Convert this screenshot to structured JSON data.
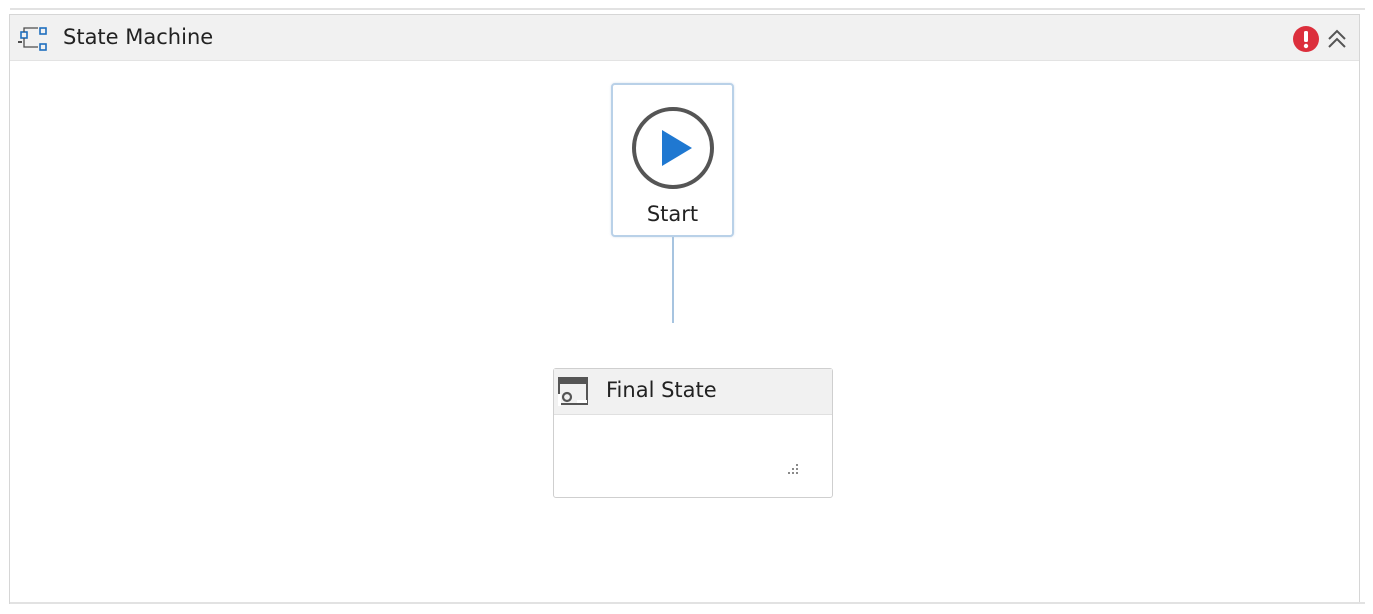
{
  "state_machine": {
    "title": "State Machine",
    "icons": {
      "type_icon": "state-machine-icon",
      "error_icon": "error-icon",
      "collapse_icon": "double-chevron-up-icon"
    },
    "colors": {
      "error": "#dc2f3c",
      "accent": "#1f78d1",
      "connector": "#a7c4e0"
    }
  },
  "nodes": {
    "start": {
      "label": "Start",
      "icon": "play-circle-icon"
    },
    "final_state": {
      "label": "Final State",
      "icon": "final-state-icon"
    }
  }
}
